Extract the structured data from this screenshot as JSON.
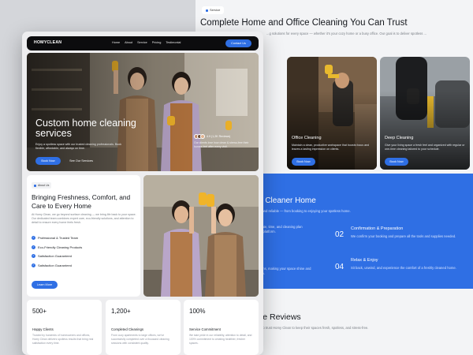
{
  "back_page": {
    "section_tag": "Service",
    "title": "Complete Home and Office Cleaning You Can Trust",
    "description": "...g solutions for every space — whether it's your cozy home or a busy office. Our goal is to deliver spotless ...",
    "cards": [
      {
        "title": "",
        "description": "",
        "button": ""
      },
      {
        "title": "Office Cleaning",
        "description": "Maintain a clean, productive workspace that boosts focus and leaves a lasting impression on clients.",
        "button": "Book Now"
      },
      {
        "title": "Deep Cleaning",
        "description": "Give your living space a fresh feel and organized with regular or one-time cleaning tailored to your schedule.",
        "button": "Book Now"
      }
    ],
    "process": {
      "title": "a Cleaner Home",
      "subtitle": ", and reliable — from booking to enjoying your spotless home.",
      "left_fragments": [
        "date, time, and cleaning plan",
        "e platform.",
        "tims, making your space shine and",
        "on."
      ],
      "steps": [
        {
          "number": "02",
          "title": "Confirmation & Preparation",
          "description": "We confirm your booking and prepare all the tools and supplies needed."
        },
        {
          "number": "04",
          "title": "Relax & Enjoy",
          "description": "Sit back, unwind, and experience the comfort of a freshly cleaned home."
        }
      ]
    },
    "reviews": {
      "title": "ve Reviews",
      "subtitle": "who trust Homy Clean to keep their spaces fresh, spotless, and stress-free."
    }
  },
  "front_page": {
    "nav": {
      "logo": "HOMYCLEAN",
      "links": [
        "Home",
        "About",
        "Service",
        "Pricing",
        "Testimonial"
      ],
      "cta": "Contact Us"
    },
    "hero": {
      "title": "Custom home cleaning services",
      "description": "Enjoy a spotless space with our trusted cleaning professionals. Book flexible, affordable, and always on time.",
      "primary_button": "Book Now",
      "secondary_button": "See Our Services",
      "rating": "4.9 (1,2K Reviews)",
      "review_note": "Our clients love how clean & stress-free their homes feel after every visit."
    },
    "about": {
      "tag": "About Us",
      "title": "Bringing Freshness, Comfort, and Care to Every Home",
      "description": "At Homy Clean, we go beyond surface cleaning — we bring life back to your space. Our dedicated team combines expert care, eco-friendly solutions, and attention to detail to ensure every home feels fresh.",
      "features": [
        "Professional & Trusted Team",
        "Eco-Friendly Cleaning Products",
        "Satisfaction Guaranteed",
        "Satisfaction Guaranteed"
      ],
      "button": "Learn More"
    },
    "stats": [
      {
        "value": "500+",
        "label": "Happy Clients",
        "description": "Trusted by hundreds of homeowners and offices, Homy Clean delivers spotless results that bring real satisfaction every time."
      },
      {
        "value": "1,200+",
        "label": "Completed Cleanings",
        "description": "From cozy apartments to large offices, we've successfully completed over a thousand cleaning sessions with consistent quality."
      },
      {
        "value": "100%",
        "label": "Service Commitment",
        "description": "We take pride in our reliability, attention to detail, and 100% commitment to creating healthier, fresher spaces."
      }
    ]
  },
  "colors": {
    "accent": "#2f6fe4",
    "nav_bg": "#0c0c0e",
    "page_bg": "#ededef",
    "text": "#14171c"
  }
}
